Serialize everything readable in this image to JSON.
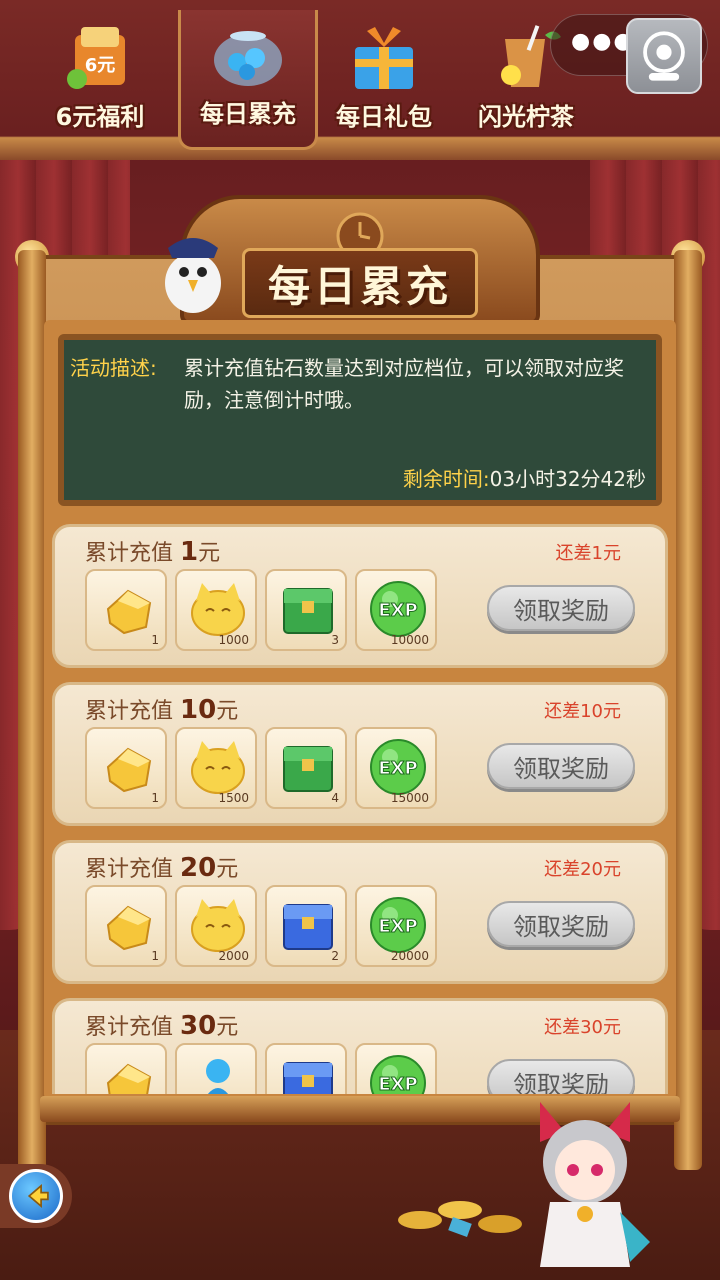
{
  "tabs": [
    {
      "label": "6元福利",
      "icon": "red-envelope-icon",
      "active": false
    },
    {
      "label": "每日累充",
      "icon": "diamond-jar-icon",
      "active": true
    },
    {
      "label": "每日礼包",
      "icon": "gift-box-icon",
      "active": false
    },
    {
      "label": "闪光柠茶",
      "icon": "lemon-tea-icon",
      "active": false
    }
  ],
  "title": "每日累充",
  "activity": {
    "label": "活动描述:",
    "description": "累计充值钻石数量达到对应档位，可以领取对应奖励，注意倒计时哦。",
    "timer_label": "剩余时间:",
    "timer_value": "03小时32分42秒"
  },
  "tiers": [
    {
      "prefix": "累计充值",
      "amount": "1",
      "unit": "元",
      "need": "还差1元",
      "claim": "领取奖励",
      "items": [
        {
          "icon": "gold-block-icon",
          "qty": "1"
        },
        {
          "icon": "cat-coin-icon",
          "qty": "1000"
        },
        {
          "icon": "green-chest-icon",
          "qty": "3"
        },
        {
          "icon": "exp-orb-icon",
          "qty": "10000"
        }
      ]
    },
    {
      "prefix": "累计充值",
      "amount": "10",
      "unit": "元",
      "need": "还差10元",
      "claim": "领取奖励",
      "items": [
        {
          "icon": "gold-block-icon",
          "qty": "1"
        },
        {
          "icon": "cat-coin-icon",
          "qty": "1500"
        },
        {
          "icon": "green-chest-icon",
          "qty": "4"
        },
        {
          "icon": "exp-orb-icon",
          "qty": "15000"
        }
      ]
    },
    {
      "prefix": "累计充值",
      "amount": "20",
      "unit": "元",
      "need": "还差20元",
      "claim": "领取奖励",
      "items": [
        {
          "icon": "gold-block-icon",
          "qty": "1"
        },
        {
          "icon": "cat-coin-icon",
          "qty": "2000"
        },
        {
          "icon": "blue-chest-icon",
          "qty": "2"
        },
        {
          "icon": "exp-orb-icon",
          "qty": "20000"
        }
      ]
    },
    {
      "prefix": "累计充值",
      "amount": "30",
      "unit": "元",
      "need": "还差30元",
      "claim": "领取奖励",
      "items": [
        {
          "icon": "gold-block-icon",
          "qty": ""
        },
        {
          "icon": "blue-figure-icon",
          "qty": ""
        },
        {
          "icon": "blue-chest-icon",
          "qty": ""
        },
        {
          "icon": "exp-orb-icon",
          "qty": ""
        }
      ]
    }
  ],
  "exp_text": "EXP",
  "colors": {
    "accent_text": "#d9432b",
    "chalkboard": "#2f4a3a",
    "highlight": "#ffd24a"
  }
}
